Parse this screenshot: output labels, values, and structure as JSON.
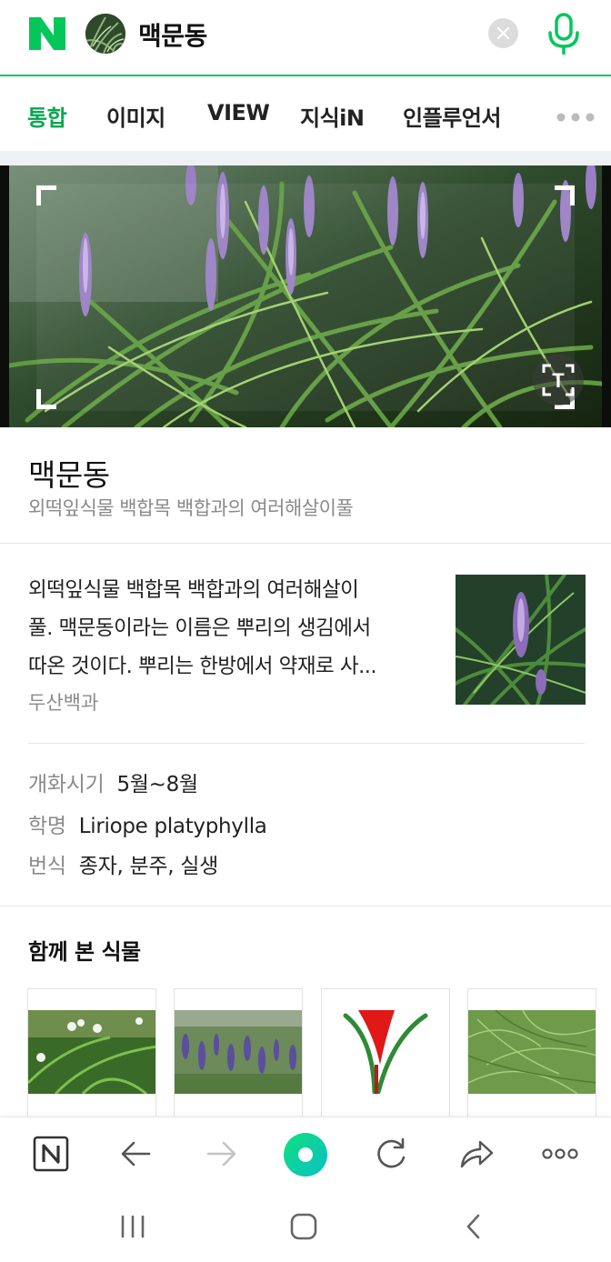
{
  "search": {
    "logo_letter": "N",
    "query": "맥문동",
    "clear_icon": "close-icon",
    "mic_icon": "microphone-icon",
    "accent_color": "#03c75a"
  },
  "tabs": [
    {
      "label": "통합",
      "active": true
    },
    {
      "label": "이미지"
    },
    {
      "label": "VIEW"
    },
    {
      "label": "지식iN"
    },
    {
      "label": "인플루언서"
    }
  ],
  "hero": {
    "lens_label": "T"
  },
  "entry": {
    "title": "맥문동",
    "subtitle": "외떡잎식물 백합목 백합과의 여러해살이풀",
    "description_lines": [
      "외떡잎식물 백합목 백합과의 여러해살이",
      "풀. 맥문동이라는 이름은 뿌리의 생김에서",
      "따온 것이다. 뿌리는 한방에서 약재로 사..."
    ],
    "source": "두산백과"
  },
  "facts": [
    {
      "key": "개화시기",
      "value": "5월~8월"
    },
    {
      "key": "학명",
      "value": "Liriope platyphylla"
    },
    {
      "key": "번식",
      "value": "종자, 분주, 실생"
    }
  ],
  "related": {
    "title": "함께 본 식물"
  },
  "toolbar": {
    "icons": [
      "naver-home-icon",
      "back-arrow-icon",
      "forward-arrow-icon",
      "green-dot-icon",
      "refresh-icon",
      "share-icon",
      "more-icon"
    ]
  },
  "navbar": {
    "icons": [
      "recent-apps-icon",
      "home-icon",
      "back-icon"
    ]
  }
}
